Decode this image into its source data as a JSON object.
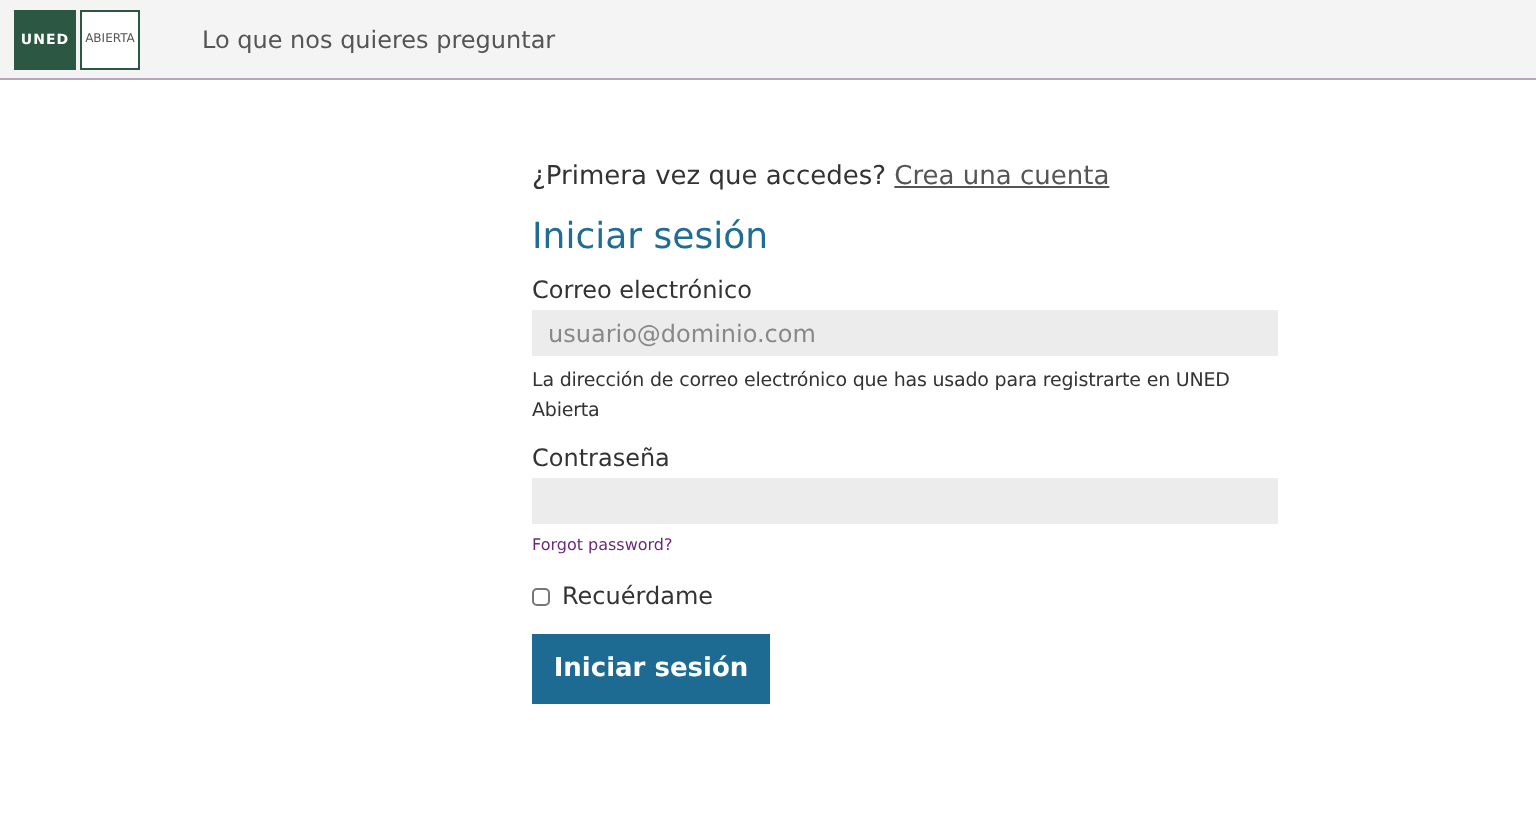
{
  "header": {
    "logo": {
      "mark": "UNED",
      "sub": "ABIERTA"
    },
    "link": "Lo que nos quieres preguntar"
  },
  "form": {
    "register_prompt": "¿Primera vez que accedes?",
    "register_link": "Crea una cuenta",
    "title": "Iniciar sesión",
    "fields": [
      {
        "label": "Correo electrónico",
        "placeholder": "usuario@dominio.com",
        "help": "La dirección de correo electrónico que has usado para registrarte en UNED Abierta"
      },
      {
        "label": "Contraseña",
        "link": "Forgot password?"
      }
    ],
    "remember": {
      "label": "Recuérdame",
      "checked": false
    },
    "submit": "Iniciar sesión"
  }
}
